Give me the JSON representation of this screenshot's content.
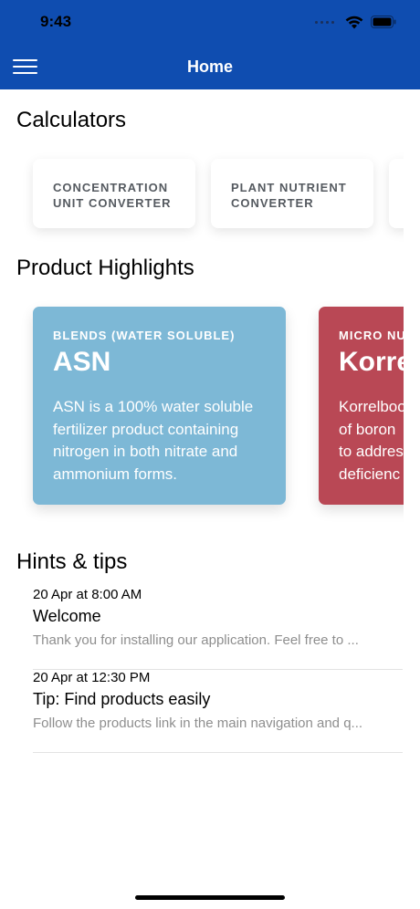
{
  "status_bar": {
    "time": "9:43"
  },
  "nav": {
    "title": "Home",
    "menu_icon": "hamburger-menu-icon"
  },
  "calculators": {
    "title": "Calculators",
    "items": [
      {
        "label": "CONCENTRATION UNIT CONVERTER"
      },
      {
        "label": "PLANT NUTRIENT CONVERTER"
      },
      {
        "label": ""
      }
    ]
  },
  "products": {
    "title": "Product Highlights",
    "items": [
      {
        "category": "BLENDS (WATER SOLUBLE)",
        "name": "ASN",
        "description": "ASN is a 100% water soluble\nfertilizer product containing\nnitrogen in both nitrate and\nammonium forms.",
        "color": "#7db8d6"
      },
      {
        "category": "MICRO NU",
        "name": "Korre",
        "description": "Korrelboo\nof boron \nto addres\ndeficienc",
        "color": "#b94855"
      }
    ]
  },
  "hints": {
    "title": "Hints & tips",
    "items": [
      {
        "date": "20 Apr at 8:00 AM",
        "title": "Welcome",
        "body": "Thank you for installing our application. Feel free to ..."
      },
      {
        "date": "20 Apr at 12:30 PM",
        "title": "Tip: Find products easily",
        "body": "Follow the products link in the main navigation and q..."
      }
    ]
  },
  "colors": {
    "header": "#0f4db0",
    "text": "#000000",
    "muted": "#8e8e8e"
  }
}
